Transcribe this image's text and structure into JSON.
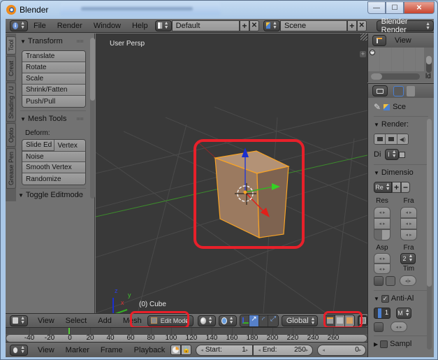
{
  "window": {
    "title": "Blender",
    "controls": {
      "minimize": "—",
      "maximize": "☐",
      "close": "✕"
    }
  },
  "header": {
    "editor_icon": "info-icon",
    "menus": [
      "File",
      "Render",
      "Window",
      "Help"
    ],
    "screen_layout": "Default",
    "scene": "Scene",
    "render_engine": "Blender Render"
  },
  "tool_shelf": {
    "tabs": [
      "Tool",
      "Creat",
      "Shading / U",
      "Optio",
      "Grease Pen"
    ],
    "active_tab": "Tool",
    "panels": {
      "transform": {
        "title": "Transform",
        "buttons": [
          "Translate",
          "Rotate",
          "Scale",
          "Shrink/Fatten",
          "Push/Pull"
        ]
      },
      "mesh_tools": {
        "title": "Mesh Tools",
        "deform_label": "Deform:",
        "row_buttons": [
          "Slide Ed",
          "Vertex"
        ],
        "buttons": [
          "Noise",
          "Smooth Vertex",
          "Randomize"
        ]
      },
      "toggle_editmode": {
        "title": "Toggle Editmode"
      }
    }
  },
  "viewport": {
    "view_label": "User Persp",
    "object_label": "(0) Cube",
    "axis_labels": {
      "x": "x",
      "y": "y",
      "z": "z"
    },
    "colors": {
      "x_axis": "#e0201a",
      "y_axis": "#36b024",
      "z_axis": "#1a2fd0",
      "selection": "#f7a326",
      "highlight": "#e8202a"
    }
  },
  "outliner": {
    "display_mode_label": "View",
    "partial_label": "ld"
  },
  "properties": {
    "context_label": "Sce",
    "render_panel": {
      "title": "Render:",
      "display_label": "Di",
      "display_value": "I"
    },
    "dimensions_panel": {
      "title": "Dimensio",
      "preset_label": "Re",
      "resolution_label": "Res",
      "frame_label": "Fra",
      "aspect_label": "Asp",
      "frame_rate_label": "Fra",
      "frame_rate_value": "2",
      "time_label": "Tim"
    },
    "anti_alias_panel": {
      "title": "Anti-Al",
      "checked": true,
      "samples_value": "1",
      "filter_value": "M"
    },
    "sampling_panel": {
      "title": "Sampl",
      "checked": false
    }
  },
  "view3d_header": {
    "menus": [
      "View",
      "Select",
      "Add",
      "Mesh"
    ],
    "mode": "Edit Mode",
    "orientation": "Global"
  },
  "timeline": {
    "ticks": [
      "-40",
      "-20",
      "0",
      "20",
      "40",
      "60",
      "80",
      "100",
      "120",
      "140",
      "160",
      "180",
      "200",
      "220",
      "240",
      "260"
    ],
    "current_frame_marker": "0"
  },
  "timeline_header": {
    "menus": [
      "View",
      "Marker",
      "Frame",
      "Playback"
    ],
    "start_label": "Start:",
    "start_value": "1",
    "end_label": "End:",
    "end_value": "250",
    "current_frame": "0"
  }
}
